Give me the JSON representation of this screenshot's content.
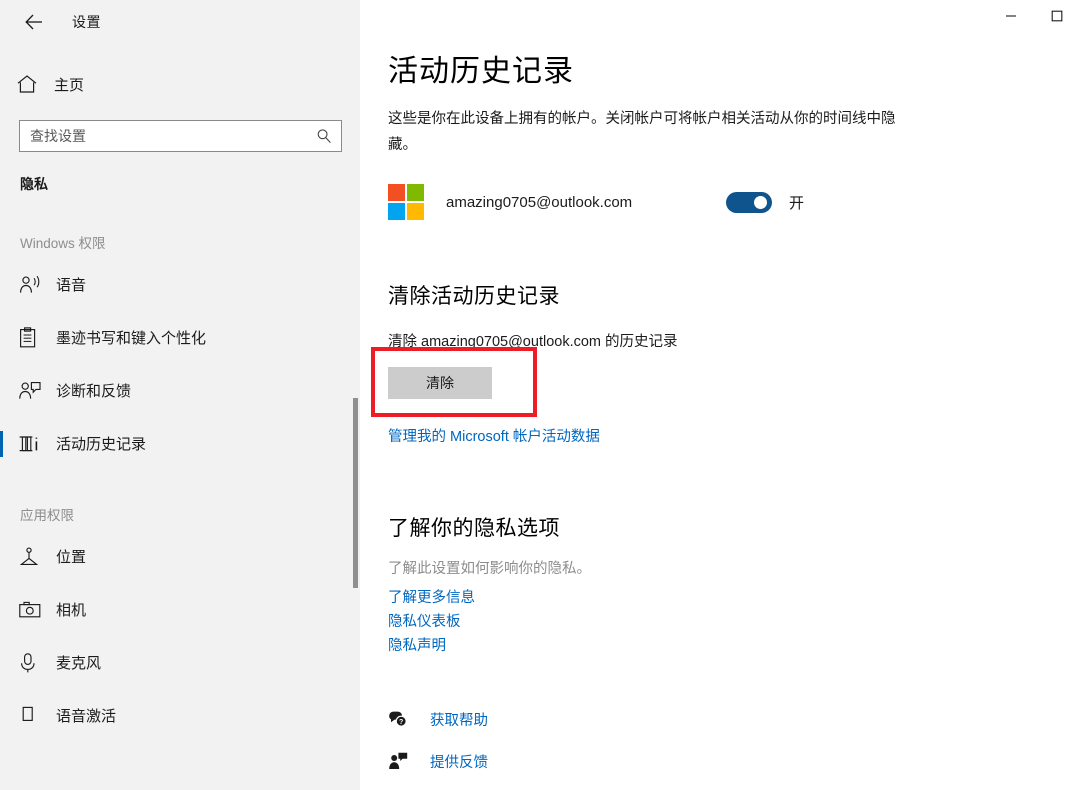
{
  "window": {
    "app_title": "设置",
    "back_icon": "back-arrow-icon",
    "minimize_label": "—",
    "maximize_label": "□"
  },
  "sidebar": {
    "home": {
      "label": "主页",
      "icon": "home-icon"
    },
    "search": {
      "placeholder": "查找设置",
      "value": "",
      "icon": "search-icon"
    },
    "category": "隐私",
    "groups": [
      {
        "header": "Windows 权限",
        "items": [
          {
            "label": "语音",
            "icon": "speech-icon",
            "active": false
          },
          {
            "label": "墨迹书写和键入个性化",
            "icon": "clipboard-icon",
            "active": false
          },
          {
            "label": "诊断和反馈",
            "icon": "feedback-person-icon",
            "active": false
          },
          {
            "label": "活动历史记录",
            "icon": "activity-history-icon",
            "active": true
          }
        ]
      },
      {
        "header": "应用权限",
        "items": [
          {
            "label": "位置",
            "icon": "location-icon",
            "active": false
          },
          {
            "label": "相机",
            "icon": "camera-icon",
            "active": false
          },
          {
            "label": "麦克风",
            "icon": "microphone-icon",
            "active": false
          },
          {
            "label": "语音激活",
            "icon": "voice-activation-icon",
            "active": false
          }
        ]
      }
    ]
  },
  "main": {
    "page_title": "活动历史记录",
    "description": "这些是你在此设备上拥有的帐户。关闭帐户可将帐户相关活动从你的时间线中隐藏。",
    "account": {
      "email": "amazing0705@outlook.com",
      "logo": "microsoft-logo-icon",
      "toggle_state": "on",
      "toggle_label": "开"
    },
    "clear_section": {
      "heading": "清除活动历史记录",
      "description": "清除 amazing0705@outlook.com 的历史记录",
      "button_label": "清除",
      "manage_link": "管理我的 Microsoft 帐户活动数据"
    },
    "privacy_section": {
      "heading": "了解你的隐私选项",
      "subtext": "了解此设置如何影响你的隐私。",
      "links": [
        "了解更多信息",
        "隐私仪表板",
        "隐私声明"
      ]
    },
    "footer": [
      {
        "label": "获取帮助",
        "icon": "help-bubble-icon"
      },
      {
        "label": "提供反馈",
        "icon": "feedback-person-icon"
      }
    ]
  },
  "annotation": {
    "highlight_color": "#ee1c25",
    "target": "清除"
  },
  "colors": {
    "accent": "#0067c0",
    "active_indicator": "#0063b1",
    "toggle_on": "#0f548c",
    "sidebar_bg": "#f2f2f2",
    "content_bg": "#ffffff",
    "ms_red": "#f25022",
    "ms_green": "#7fba00",
    "ms_blue": "#00a4ef",
    "ms_yellow": "#ffb900"
  }
}
